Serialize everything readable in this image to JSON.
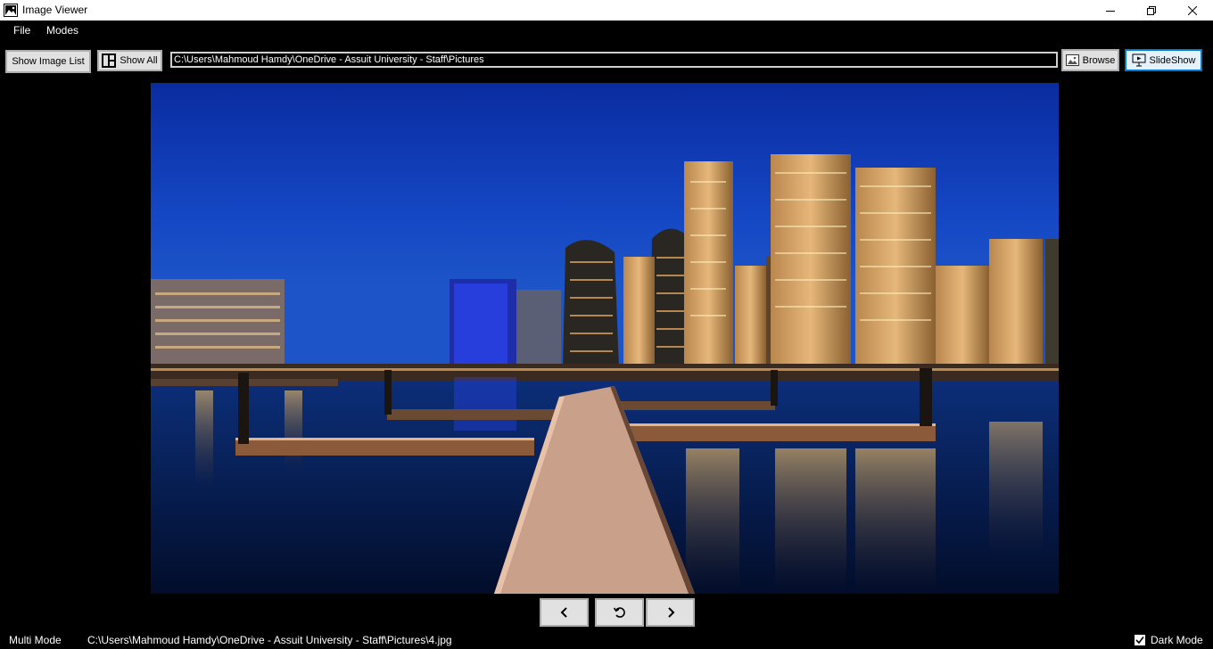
{
  "window": {
    "title": "Image Viewer"
  },
  "menu": {
    "items": [
      {
        "label": "File"
      },
      {
        "label": "Modes"
      }
    ]
  },
  "toolbar": {
    "show_image_list_label": "Show Image List",
    "show_all_label": "Show All",
    "path_value": "C:\\Users\\Mahmoud Hamdy\\OneDrive - Assuit University - Staff\\Pictures",
    "browse_label": "Browse",
    "slideshow_label": "SlideShow"
  },
  "viewer": {
    "image_subject": "night city skyline with marina walkway"
  },
  "navigation": {
    "prev_icon": "chevron-left-icon",
    "rotate_icon": "rotate-icon",
    "next_icon": "chevron-right-icon"
  },
  "status": {
    "mode": "Multi Mode",
    "current_file": "C:\\Users\\Mahmoud Hamdy\\OneDrive - Assuit University - Staff\\Pictures\\4.jpg",
    "dark_mode_label": "Dark Mode",
    "dark_mode_checked": true
  },
  "colors": {
    "background": "#000000",
    "button_face": "#e1e1e1",
    "accent": "#0078d7"
  }
}
